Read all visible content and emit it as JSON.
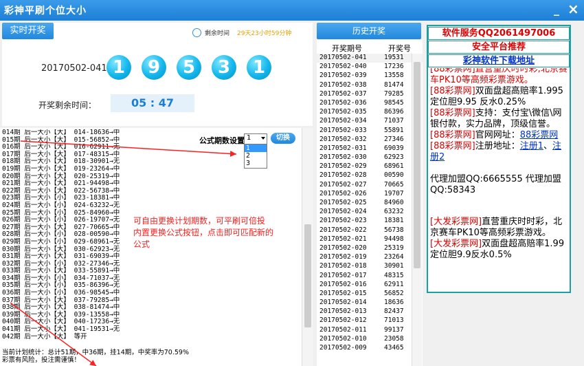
{
  "window": {
    "title": "彩神平刷个位大小",
    "minimize": "_",
    "close": "×"
  },
  "live": {
    "tab_label": "实时开奖",
    "countdown_label": "剩余时间",
    "countdown_value": "29天23小时59分钟",
    "period": "20170502-041",
    "balls": [
      "1",
      "9",
      "5",
      "3",
      "1"
    ],
    "remaining_label": "开奖剩余时间：",
    "remaining_value": "05 : 47"
  },
  "formula": {
    "label": "公式期数设置",
    "selected": "1",
    "options": [
      "1",
      "2",
      "3"
    ],
    "switch_label": "切换"
  },
  "annotation": "可自由更换计划期数，可平刷可倍投\n内置更换公式按钮，点击即可匹配新的\n公式",
  "log": {
    "lines": [
      "014期 后一大小【大】 014-18636→中",
      "015期 后一大小【大】 015-56852→中",
      "016期 后一大小【大】 016-62911→无",
      "017期 后一大小【大】 017-48315→中",
      "018期 后一大小【大】 018-30901→无",
      "019期 后一大小【大】 019-23264→中",
      "020期 后一大小【大】 020-25319→中",
      "021期 后一大小【大】 021-94498→中",
      "022期 后一大小【大】 022-56738→中",
      "023期 后一大小【小】 023-18381→中",
      "024期 后一大小【小】 024-63232→无",
      "025期 后一大小【小】 025-84960→中",
      "026期 后一大小【小】 026-19707→无",
      "027期 后一大小【大】 027-70665→中",
      "028期 后一大小【小】 028-00590→中",
      "029期 后一大小【小】 029-68961→无",
      "030期 后一大小【大】 030-62923→无",
      "031期 后一大小【大】 031-69039→中",
      "032期 后一大小【小】 032-27346→无",
      "033期 后一大小【大】 033-55891→中",
      "034期 后一大小【小】 034-71037→无",
      "035期 后一大小【小】 035-86396→无",
      "036期 后一大小【小】 036-98545→中",
      "037期 后一大小【大】 037-79285→中",
      "038期 后一大小【大】 038-81474→中",
      "039期 后一大小【大】 039-13558→中",
      "040期 后一大小【大】 040-17236→无",
      "041期 后一大小【大】 041-19531→无",
      "042期 后一大小【大】 等开"
    ],
    "stats": "当前计划统计：总计51期，中36期，挂14期，中奖率为70.59%",
    "risk": "彩票有风险，投注需谨慎！"
  },
  "history": {
    "tab_label": "历史开奖",
    "col_period": "开奖期号",
    "col_number": "开奖号",
    "rows": [
      [
        "20170502-041",
        "19531"
      ],
      [
        "20170502-040",
        "17236"
      ],
      [
        "20170502-039",
        "13558"
      ],
      [
        "20170502-038",
        "81474"
      ],
      [
        "20170502-037",
        "79285"
      ],
      [
        "20170502-036",
        "98545"
      ],
      [
        "20170502-035",
        "86396"
      ],
      [
        "20170502-034",
        "71037"
      ],
      [
        "20170502-033",
        "55891"
      ],
      [
        "20170502-032",
        "27346"
      ],
      [
        "20170502-031",
        "69039"
      ],
      [
        "20170502-030",
        "62923"
      ],
      [
        "20170502-029",
        "68961"
      ],
      [
        "20170502-028",
        "00590"
      ],
      [
        "20170502-027",
        "70665"
      ],
      [
        "20170502-026",
        "19707"
      ],
      [
        "20170502-025",
        "84960"
      ],
      [
        "20170502-024",
        "63232"
      ],
      [
        "20170502-023",
        "18381"
      ],
      [
        "20170502-022",
        "56738"
      ],
      [
        "20170502-021",
        "94498"
      ],
      [
        "20170502-020",
        "25319"
      ],
      [
        "20170502-019",
        "23264"
      ],
      [
        "20170502-018",
        "30901"
      ],
      [
        "20170502-017",
        "48315"
      ],
      [
        "20170502-016",
        "62911"
      ],
      [
        "20170502-015",
        "56852"
      ],
      [
        "20170502-014",
        "18636"
      ],
      [
        "20170502-013",
        "82437"
      ],
      [
        "20170502-012",
        "71013"
      ],
      [
        "20170502-011",
        "99137"
      ],
      [
        "20170502-010",
        "23058"
      ],
      [
        "20170502-009",
        "43465"
      ]
    ]
  },
  "ads": {
    "service": "软件服务QQ2061497006",
    "recommend": "安全平台推荐",
    "download": "彩神软件下载地址",
    "p1_tail": "[88彩票网]直营重庆时时彩,北京赛车PK10等高频彩票游戏。",
    "p2_tag": "[88彩票网]",
    "p2_text": "双面盘超高赔率1.995 定位胆9.95 反水0.25%",
    "p3_tag": "[88彩票网]",
    "p3_text": "支持：支付宝\\微信\\网银付款，实力品牌，顶级信誉。",
    "p4_tag": "[88彩票网]",
    "p4_text": "官网网址：",
    "p4_link": "88彩票网",
    "p5_tag": "[88彩票网]",
    "p5_text": "注册地址：",
    "p5_link1": "注册1",
    "p5_sep": "、",
    "p5_link2": "注册2",
    "agent": "代理加盟QQ:6665555 代理加盟QQ:58343",
    "p6_tag": "[大发彩票网]",
    "p6_text": "直营重庆时时彩，北京赛车PK10等高频彩票游戏。",
    "p7_tag": "[大发彩票网]",
    "p7_text": "双面盘超高赔率1.99 定位胆9.9反水0.5%"
  }
}
